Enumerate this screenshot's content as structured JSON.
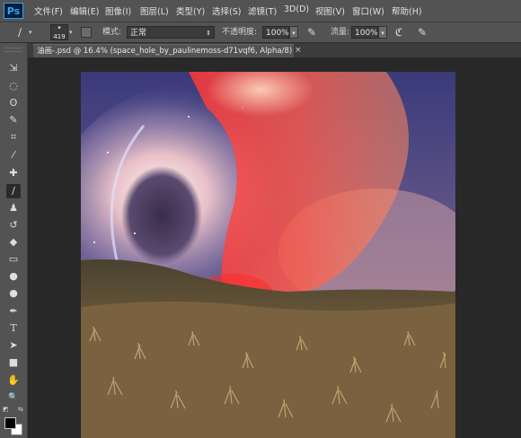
{
  "app": {
    "logo": "Ps"
  },
  "menu": [
    "文件(F)",
    "编辑(E)",
    "图像(I)",
    "图层(L)",
    "类型(Y)",
    "选择(S)",
    "滤镜(T)",
    "3D(D)",
    "视图(V)",
    "窗口(W)",
    "帮助(H)"
  ],
  "options": {
    "brush_size": "419",
    "mode_label": "模式:",
    "mode_value": "正常",
    "opacity_label": "不透明度:",
    "opacity_value": "100%",
    "flow_label": "流量:",
    "flow_value": "100%"
  },
  "document": {
    "tab_title": "油画-.psd @ 16.4% (space_hole_by_paulinemoss-d71vqf6, Alpha/8) *",
    "close_glyph": "×"
  },
  "tools": [
    {
      "name": "move-tool",
      "icon": "move-icon",
      "glyph": "⇲"
    },
    {
      "name": "marquee-tool",
      "icon": "ellipse-marquee-icon",
      "glyph": "◌"
    },
    {
      "name": "lasso-tool",
      "icon": "lasso-icon",
      "glyph": "ʘ"
    },
    {
      "name": "quick-selection-tool",
      "icon": "quick-selection-icon",
      "glyph": "✎"
    },
    {
      "name": "crop-tool",
      "icon": "crop-icon",
      "glyph": "⌗"
    },
    {
      "name": "eyedropper-tool",
      "icon": "eyedropper-icon",
      "glyph": "⁄"
    },
    {
      "name": "healing-brush-tool",
      "icon": "bandage-icon",
      "glyph": "✚"
    },
    {
      "name": "brush-tool",
      "icon": "brush-icon",
      "glyph": "∕"
    },
    {
      "name": "clone-stamp-tool",
      "icon": "stamp-icon",
      "glyph": "♟"
    },
    {
      "name": "history-brush-tool",
      "icon": "history-brush-icon",
      "glyph": "↺"
    },
    {
      "name": "eraser-tool",
      "icon": "eraser-icon",
      "glyph": "◆"
    },
    {
      "name": "gradient-tool",
      "icon": "gradient-icon",
      "glyph": "▭"
    },
    {
      "name": "blur-tool",
      "icon": "blur-icon",
      "glyph": "●"
    },
    {
      "name": "dodge-tool",
      "icon": "dodge-icon",
      "glyph": "●"
    },
    {
      "name": "pen-tool",
      "icon": "pen-icon",
      "glyph": "✒"
    },
    {
      "name": "type-tool",
      "icon": "type-icon",
      "glyph": "T"
    },
    {
      "name": "path-selection-tool",
      "icon": "arrow-icon",
      "glyph": "➤"
    },
    {
      "name": "shape-tool",
      "icon": "rectangle-icon",
      "glyph": "■"
    },
    {
      "name": "hand-tool",
      "icon": "hand-icon",
      "glyph": "✋"
    },
    {
      "name": "zoom-tool",
      "icon": "zoom-icon",
      "glyph": "🔍"
    }
  ],
  "colors": {
    "foreground": "#000000",
    "background": "#ffffff",
    "mask_overlay": "#ff3030"
  }
}
